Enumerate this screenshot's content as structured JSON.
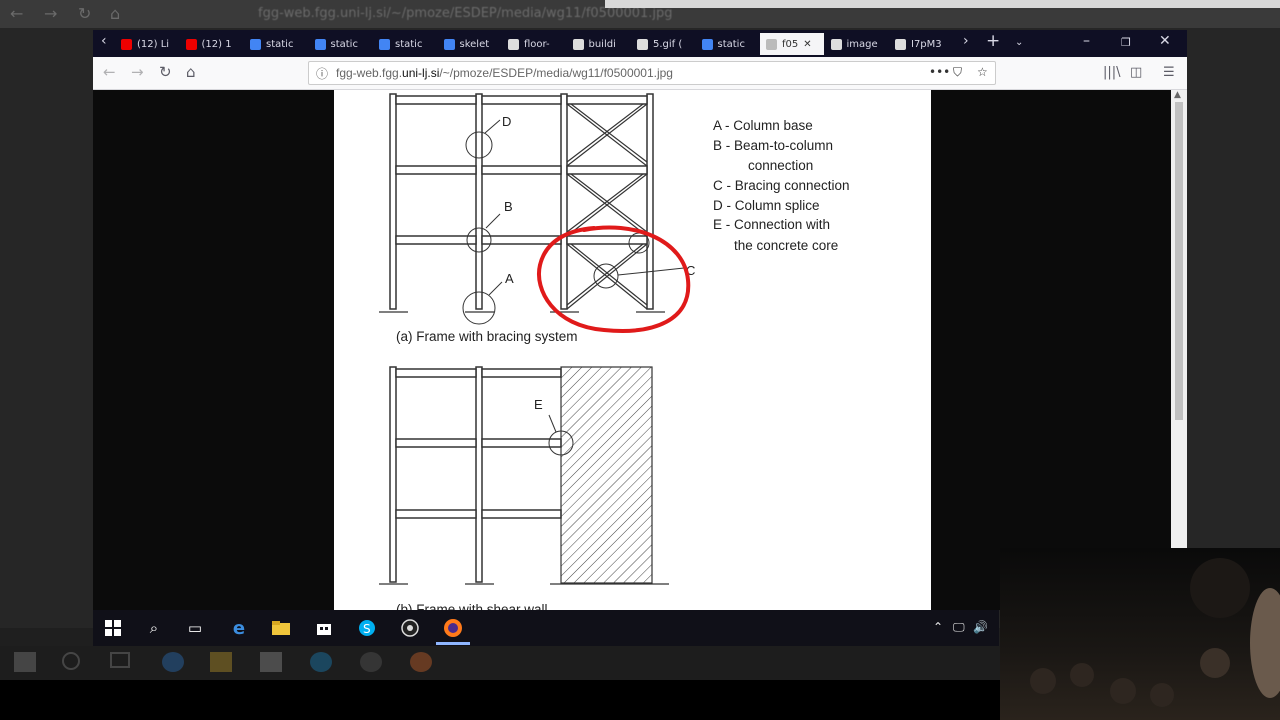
{
  "outer_browser": {
    "url": "fgg-web.fgg.uni-lj.si/~/pmoze/ESDEP/media/wg11/f0500001.jpg"
  },
  "browser": {
    "tabs": [
      {
        "label": "(12) Li",
        "icon": "youtube-icon",
        "color": "#e00"
      },
      {
        "label": "(12) 1",
        "icon": "youtube-icon",
        "color": "#e00"
      },
      {
        "label": "static",
        "icon": "google-icon",
        "color": "#4285f4"
      },
      {
        "label": "static",
        "icon": "google-icon",
        "color": "#4285f4"
      },
      {
        "label": "static",
        "icon": "google-icon",
        "color": "#4285f4"
      },
      {
        "label": "skelet",
        "icon": "google-icon",
        "color": "#4285f4"
      },
      {
        "label": "floor-",
        "icon": "page-icon",
        "color": "#ddd"
      },
      {
        "label": "buildi",
        "icon": "page-icon",
        "color": "#ddd"
      },
      {
        "label": "5.gif (",
        "icon": "image-icon",
        "color": "#ddd"
      },
      {
        "label": "static",
        "icon": "google-icon",
        "color": "#4285f4"
      },
      {
        "label": "f05",
        "icon": "image-icon",
        "color": "#bbb"
      },
      {
        "label": "image",
        "icon": "page-icon",
        "color": "#ddd"
      },
      {
        "label": "I7pM3",
        "icon": "page-icon",
        "color": "#ddd"
      }
    ],
    "active_tab_index": 10,
    "url_host": "fgg-web.fgg.",
    "url_domain": "uni-lj.si",
    "url_path": "/~/pmoze/ESDEP/media/wg11/f0500001.jpg"
  },
  "figure": {
    "labels": {
      "A": "A",
      "B": "B",
      "C": "C",
      "D": "D",
      "E": "E"
    },
    "legend": [
      "A - Column base",
      "B - Beam-to-column",
      "connection",
      "C - Bracing connection",
      "D - Column splice",
      "E - Connection with",
      "the concrete core"
    ],
    "caption_a": "(a) Frame with bracing system",
    "caption_b": "(b) Frame with shear wall"
  },
  "taskbar": {
    "icons": [
      "windows-start-icon",
      "search-icon",
      "task-view-icon",
      "edge-icon",
      "file-explorer-icon",
      "store-icon",
      "skype-icon",
      "obs-icon",
      "firefox-icon"
    ],
    "active": "firefox-icon"
  }
}
